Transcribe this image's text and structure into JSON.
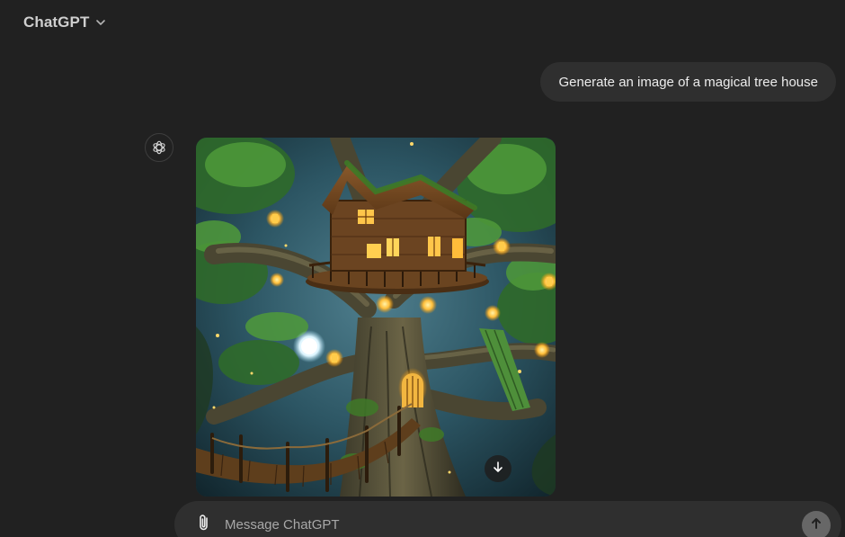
{
  "header": {
    "model_name": "ChatGPT",
    "chevron_icon": "chevron-down-icon"
  },
  "conversation": {
    "user_message": "Generate an image of a magical tree house",
    "assistant": {
      "avatar_icon": "openai-logo-icon",
      "image_subject": "magical tree house",
      "download_icon": "arrow-down-icon"
    }
  },
  "composer": {
    "placeholder": "Message ChatGPT",
    "value": "",
    "attach_icon": "paperclip-icon",
    "send_icon": "arrow-up-icon"
  },
  "colors": {
    "background": "#212121",
    "bubble": "#2f2f2f",
    "composer": "#2f2f2f",
    "send_button": "#676767",
    "text": "#ececec"
  }
}
